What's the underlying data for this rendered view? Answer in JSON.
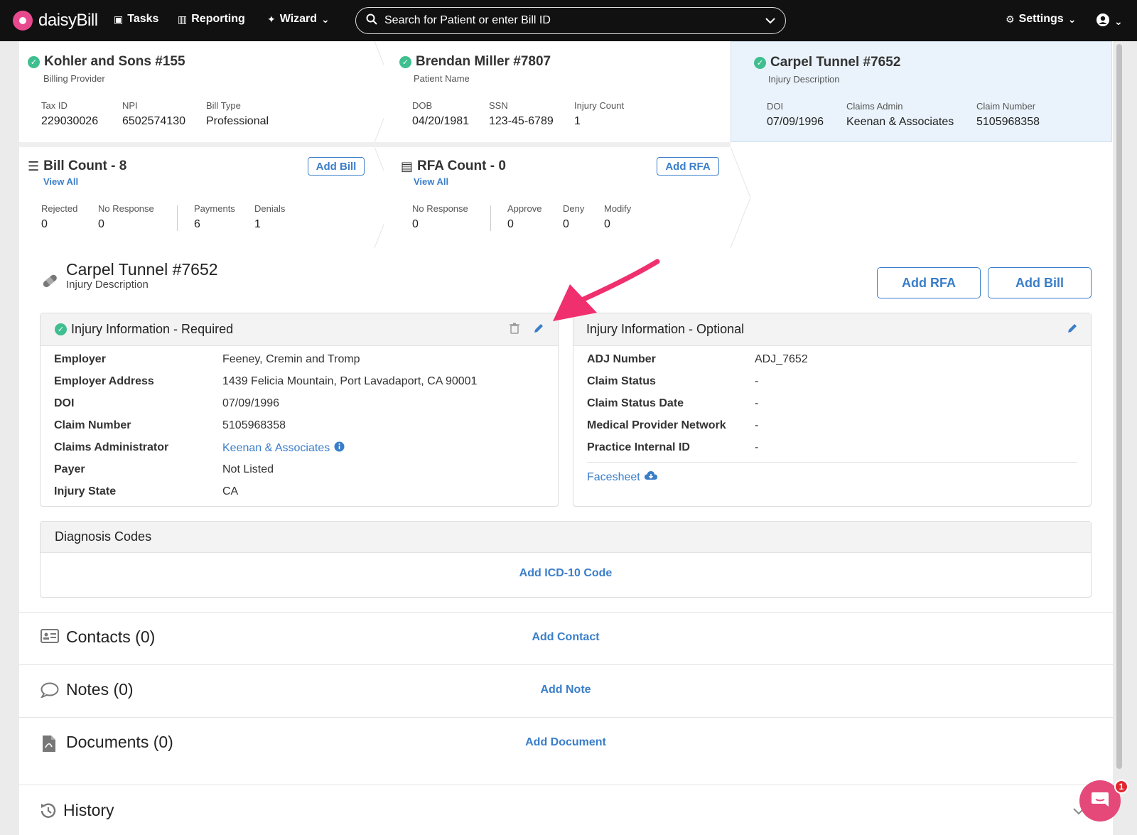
{
  "nav": {
    "brand": "daisyBill",
    "tasks": "Tasks",
    "reporting": "Reporting",
    "wizard": "Wizard",
    "search_placeholder": "Search for Patient or enter Bill ID",
    "settings": "Settings"
  },
  "provider": {
    "title": "Kohler and Sons #155",
    "subtitle": "Billing Provider",
    "fields": [
      {
        "label": "Tax ID",
        "value": "229030026"
      },
      {
        "label": "NPI",
        "value": "6502574130"
      },
      {
        "label": "Bill Type",
        "value": "Professional"
      }
    ]
  },
  "patient": {
    "title": "Brendan Miller #7807",
    "subtitle": "Patient Name",
    "fields": [
      {
        "label": "DOB",
        "value": "04/20/1981"
      },
      {
        "label": "SSN",
        "value": "123-45-6789"
      },
      {
        "label": "Injury Count",
        "value": "1"
      }
    ]
  },
  "injury_card": {
    "title": "Carpel Tunnel #7652",
    "subtitle": "Injury Description",
    "fields": [
      {
        "label": "DOI",
        "value": "07/09/1996"
      },
      {
        "label": "Claims Admin",
        "value": "Keenan & Associates"
      },
      {
        "label": "Claim Number",
        "value": "5105968358"
      }
    ]
  },
  "bill_count": {
    "title": "Bill Count - 8",
    "view_all": "View All",
    "add_label": "Add Bill",
    "fields": [
      {
        "label": "Rejected",
        "value": "0"
      },
      {
        "label": "No Response",
        "value": "0"
      },
      {
        "label": "Payments",
        "value": "6"
      },
      {
        "label": "Denials",
        "value": "1"
      }
    ]
  },
  "rfa_count": {
    "title": "RFA Count - 0",
    "view_all": "View All",
    "add_label": "Add RFA",
    "fields": [
      {
        "label": "No Response",
        "value": "0"
      },
      {
        "label": "Approve",
        "value": "0"
      },
      {
        "label": "Deny",
        "value": "0"
      },
      {
        "label": "Modify",
        "value": "0"
      }
    ]
  },
  "injury": {
    "title": "Carpel Tunnel #7652",
    "subtitle": "Injury Description",
    "add_rfa": "Add RFA",
    "add_bill": "Add Bill"
  },
  "required": {
    "title": "Injury Information - Required",
    "rows": [
      {
        "label": "Employer",
        "value": "Feeney, Cremin and Tromp"
      },
      {
        "label": "Employer Address",
        "value": "1439 Felicia Mountain, Port Lavadaport, CA 90001"
      },
      {
        "label": "DOI",
        "value": "07/09/1996"
      },
      {
        "label": "Claim Number",
        "value": "5105968358"
      },
      {
        "label": "Claims Administrator",
        "value": "Keenan & Associates"
      },
      {
        "label": "Payer",
        "value": "Not Listed"
      },
      {
        "label": "Injury State",
        "value": "CA"
      }
    ]
  },
  "optional": {
    "title": "Injury Information - Optional",
    "rows": [
      {
        "label": "ADJ Number",
        "value": "ADJ_7652"
      },
      {
        "label": "Claim Status",
        "value": "-"
      },
      {
        "label": "Claim Status Date",
        "value": "-"
      },
      {
        "label": "Medical Provider Network",
        "value": "-"
      },
      {
        "label": "Practice Internal ID",
        "value": "-"
      }
    ],
    "facesheet": "Facesheet"
  },
  "diagnosis": {
    "title": "Diagnosis Codes",
    "add_label": "Add ICD-10 Code"
  },
  "contacts": {
    "title": "Contacts (0)",
    "add_label": "Add Contact"
  },
  "notes": {
    "title": "Notes (0)",
    "add_label": "Add Note"
  },
  "documents": {
    "title": "Documents (0)",
    "add_label": "Add Document"
  },
  "history": {
    "title": "History"
  },
  "chat": {
    "badge": "1"
  },
  "colors": {
    "accent": "#3a7ec9",
    "success": "#3fbf8f",
    "annotation_arrow": "#f0306e",
    "chat": "#e5497a",
    "selected_card": "#eaf3fb"
  }
}
